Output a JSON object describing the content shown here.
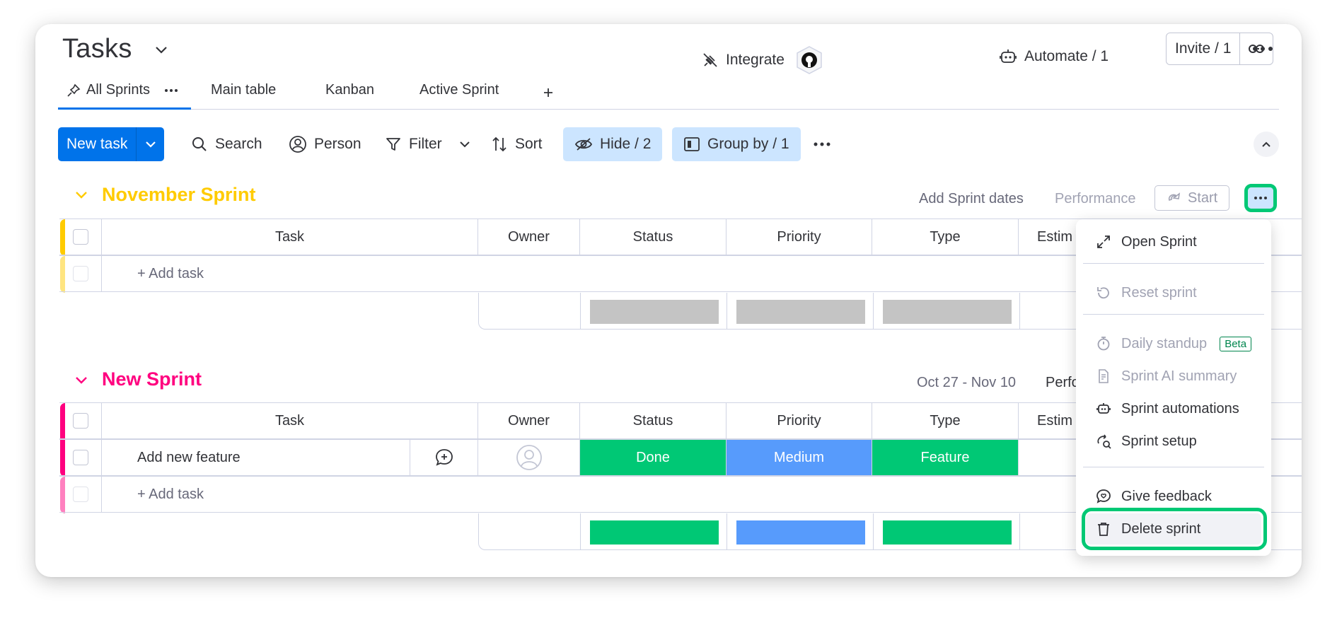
{
  "header": {
    "title": "Tasks",
    "integrate_label": "Integrate",
    "automate_label": "Automate / 1",
    "invite_label": "Invite / 1"
  },
  "tabs": [
    {
      "label": "All Sprints",
      "active": true
    },
    {
      "label": "Main table"
    },
    {
      "label": "Kanban"
    },
    {
      "label": "Active Sprint"
    }
  ],
  "toolbar": {
    "new_task": "New task",
    "search": "Search",
    "person": "Person",
    "filter": "Filter",
    "sort": "Sort",
    "hide": "Hide / 2",
    "group_by": "Group by / 1"
  },
  "columns": [
    "Task",
    "Owner",
    "Status",
    "Priority",
    "Type",
    "Estim"
  ],
  "groups": [
    {
      "title": "November Sprint",
      "color": "#ffcb00",
      "meta_dates": "Add Sprint dates",
      "meta_perf": "Performance",
      "start_label": "Start",
      "add_task": "+ Add task",
      "rows": []
    },
    {
      "title": "New Sprint",
      "color": "#ff007f",
      "meta_dates": "Oct 27 - Nov 10",
      "meta_perf": "Perfo",
      "add_task": "+ Add task",
      "rows": [
        {
          "task": "Add new feature",
          "status": "Done",
          "priority": "Medium",
          "type": "Feature"
        }
      ]
    }
  ],
  "colors": {
    "done": "#00c875",
    "medium": "#579bfc",
    "feature": "#00c875",
    "empty_summary": "#c4c4c4",
    "primary": "#0073ea",
    "highlight": "#00c875"
  },
  "menu": {
    "open_sprint": "Open Sprint",
    "reset_sprint": "Reset sprint",
    "daily_standup": "Daily standup",
    "beta": "Beta",
    "ai_summary": "Sprint AI summary",
    "automations": "Sprint automations",
    "setup": "Sprint setup",
    "feedback": "Give feedback",
    "delete": "Delete sprint"
  }
}
